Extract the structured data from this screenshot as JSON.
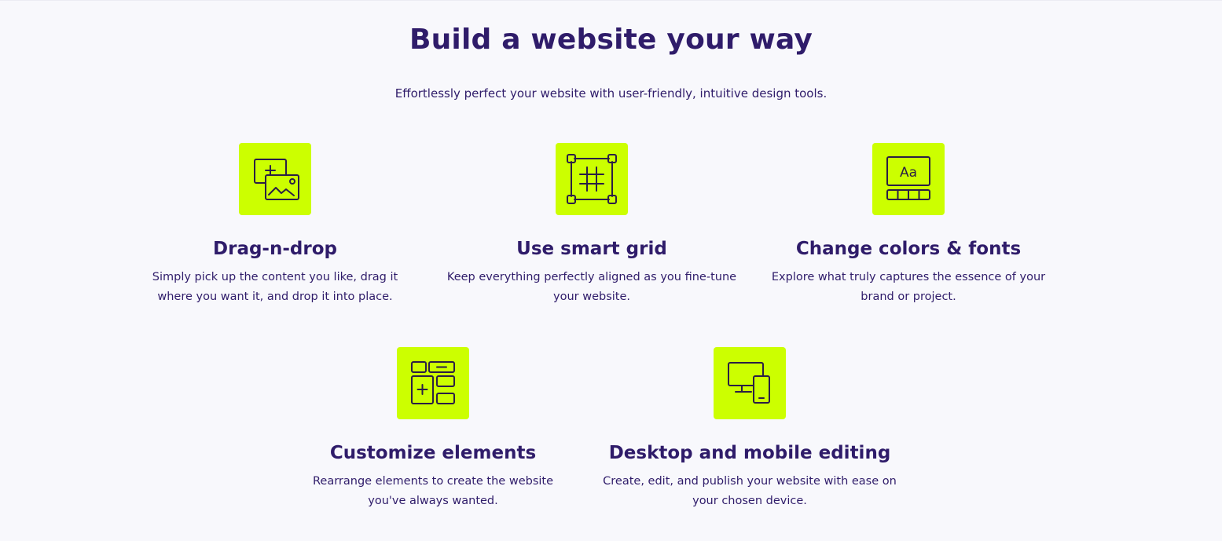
{
  "header": {
    "title": "Build a website your way",
    "subtitle": "Effortlessly perfect your website with user-friendly, intuitive design tools."
  },
  "colors": {
    "tile_background": "#ccff00",
    "heading": "#2f1c6a",
    "page_background": "#f8f8fc"
  },
  "features": [
    {
      "icon": "drag-drop-icon",
      "title": "Drag-n-drop",
      "description": "Simply pick up the content you like, drag it where you want it, and drop it into place."
    },
    {
      "icon": "smart-grid-icon",
      "title": "Use smart grid",
      "description": "Keep everything perfectly aligned as you fine-tune your website."
    },
    {
      "icon": "colors-fonts-icon",
      "title": "Change colors & fonts",
      "description": "Explore what truly captures the essence of your brand or project.",
      "icon_text": "Aa"
    },
    {
      "icon": "customize-elements-icon",
      "title": "Customize elements",
      "description": "Rearrange elements to create the website you've always wanted."
    },
    {
      "icon": "desktop-mobile-icon",
      "title": "Desktop and mobile editing",
      "description": "Create, edit, and publish your website with ease on your chosen device."
    }
  ]
}
